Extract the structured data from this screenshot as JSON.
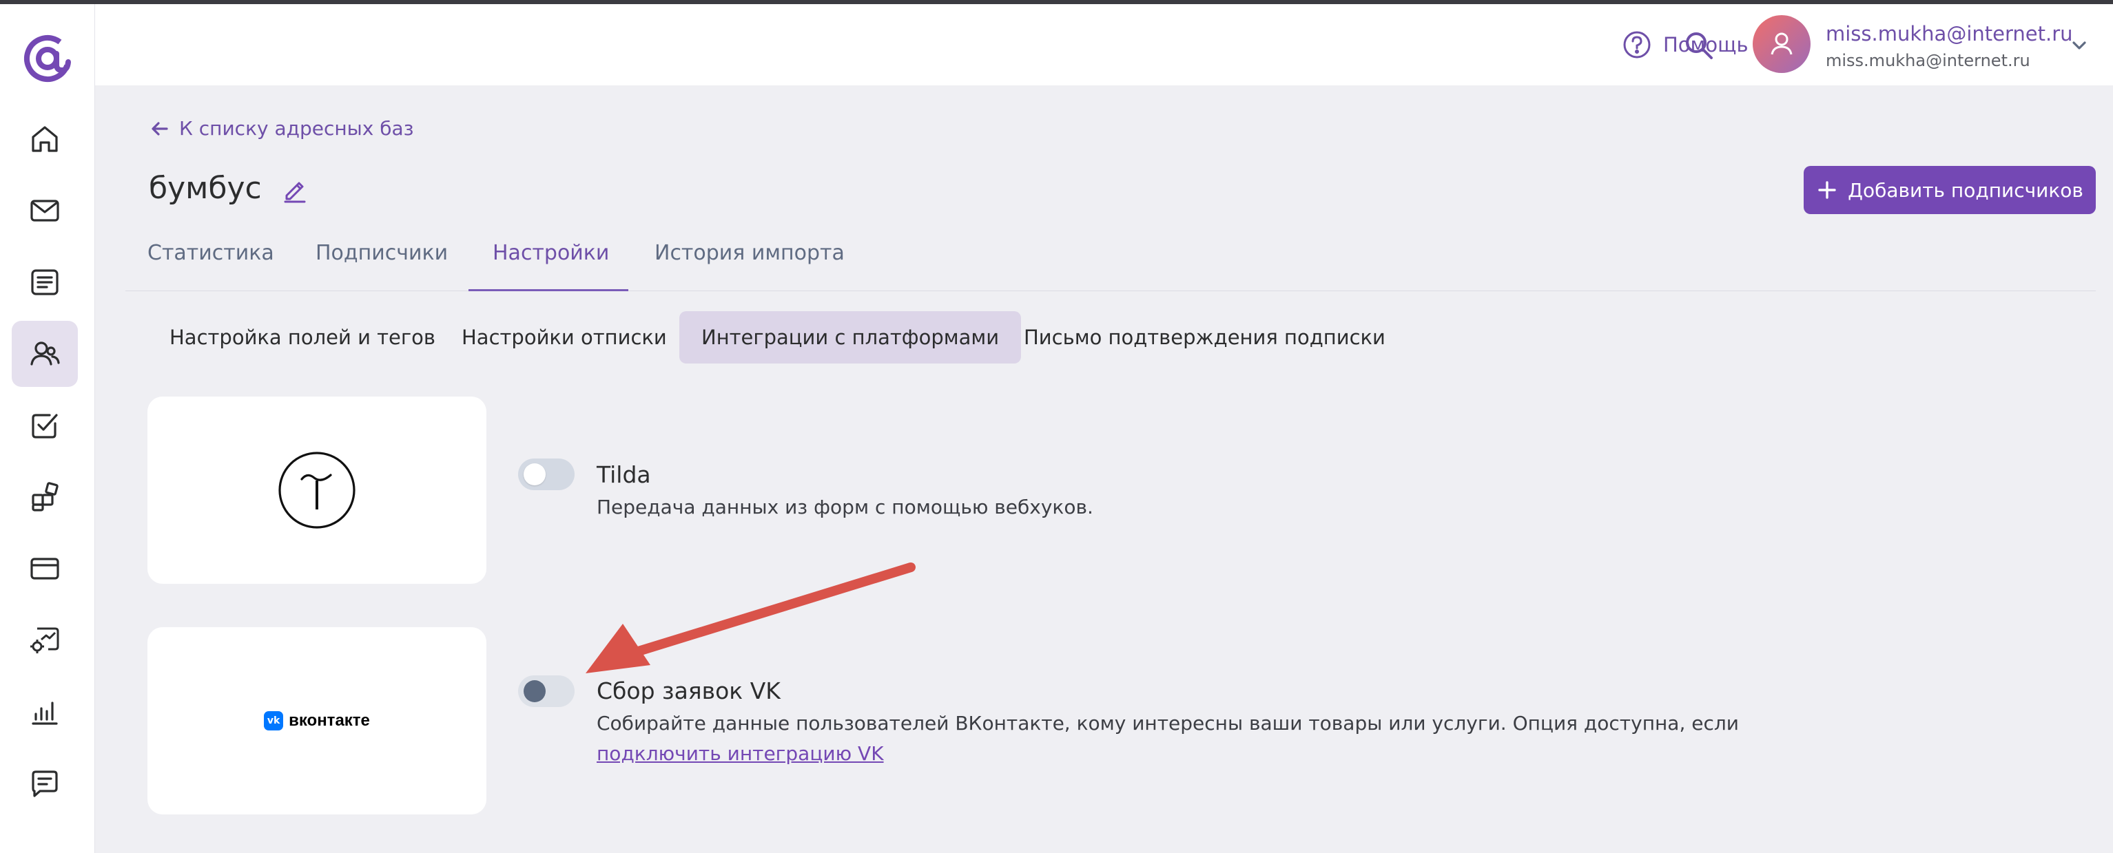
{
  "header": {
    "help_label": "Помощь",
    "user_email": "miss.mukha@internet.ru",
    "user_sub": "miss.mukha@internet.ru"
  },
  "sidebar": {
    "items": [
      {
        "name": "home",
        "icon": "home-icon"
      },
      {
        "name": "campaigns",
        "icon": "mail-icon"
      },
      {
        "name": "templates",
        "icon": "document-icon"
      },
      {
        "name": "audience",
        "icon": "users-icon",
        "active": true
      },
      {
        "name": "tasks",
        "icon": "checklist-icon"
      },
      {
        "name": "integrations",
        "icon": "blocks-icon"
      },
      {
        "name": "billing",
        "icon": "card-icon"
      },
      {
        "name": "automation",
        "icon": "settings-chart-icon"
      },
      {
        "name": "analytics",
        "icon": "bar-chart-icon"
      },
      {
        "name": "support",
        "icon": "chat-icon"
      }
    ]
  },
  "page": {
    "back_label": "К списку адресных баз",
    "title": "бумбус",
    "add_button_label": "Добавить подписчиков"
  },
  "tabs": [
    {
      "label": "Статистика",
      "active": false
    },
    {
      "label": "Подписчики",
      "active": false
    },
    {
      "label": "Настройки",
      "active": true
    },
    {
      "label": "История импорта",
      "active": false
    }
  ],
  "subtabs": [
    {
      "label": "Настройка полей и тегов",
      "active": false
    },
    {
      "label": "Настройки отписки",
      "active": false
    },
    {
      "label": "Интеграции с платформами",
      "active": true
    },
    {
      "label": "Письмо подтверждения подписки",
      "active": false
    }
  ],
  "integrations": [
    {
      "title": "Tilda",
      "description": "Передача данных из форм с помощью вебхуков.",
      "enabled": false
    },
    {
      "title": "Сбор заявок VK",
      "description": "Собирайте данные пользователей ВКонтакте, кому интересны ваши товары или услуги. Опция доступна, если",
      "link_label": "подключить интеграцию VK",
      "logo_text": "вконтакте",
      "logo_mark": "vk",
      "enabled": false,
      "disabled": true
    }
  ],
  "colors": {
    "accent": "#7448b4",
    "annotation_arrow": "#d9534a"
  }
}
